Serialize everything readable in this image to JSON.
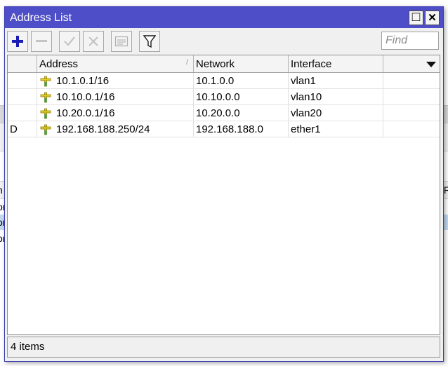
{
  "background_window": {
    "fragments_left": [
      "n",
      "or",
      "or",
      "or"
    ],
    "fragment_right": "R"
  },
  "window": {
    "title": "Address List",
    "maximize_glyph": "□",
    "close_glyph": "✕"
  },
  "toolbar": {
    "search_placeholder": "Find"
  },
  "table": {
    "columns": [
      "",
      "Address",
      "Network",
      "Interface"
    ],
    "sort_indicator": "/",
    "rows": [
      {
        "flag": "",
        "address": "10.1.0.1/16",
        "network": "10.1.0.0",
        "interface": "vlan1"
      },
      {
        "flag": "",
        "address": "10.10.0.1/16",
        "network": "10.10.0.0",
        "interface": "vlan10"
      },
      {
        "flag": "",
        "address": "10.20.0.1/16",
        "network": "10.20.0.0",
        "interface": "vlan20"
      },
      {
        "flag": "D",
        "address": "192.168.188.250/24",
        "network": "192.168.188.0",
        "interface": "ether1"
      }
    ]
  },
  "status": {
    "count_text": "4 items"
  },
  "colors": {
    "title_bar": "#4e4ec9",
    "add_icon": "#1b1bb5",
    "address_icon": "#e8d21c",
    "selection": "#c5d9f1"
  }
}
